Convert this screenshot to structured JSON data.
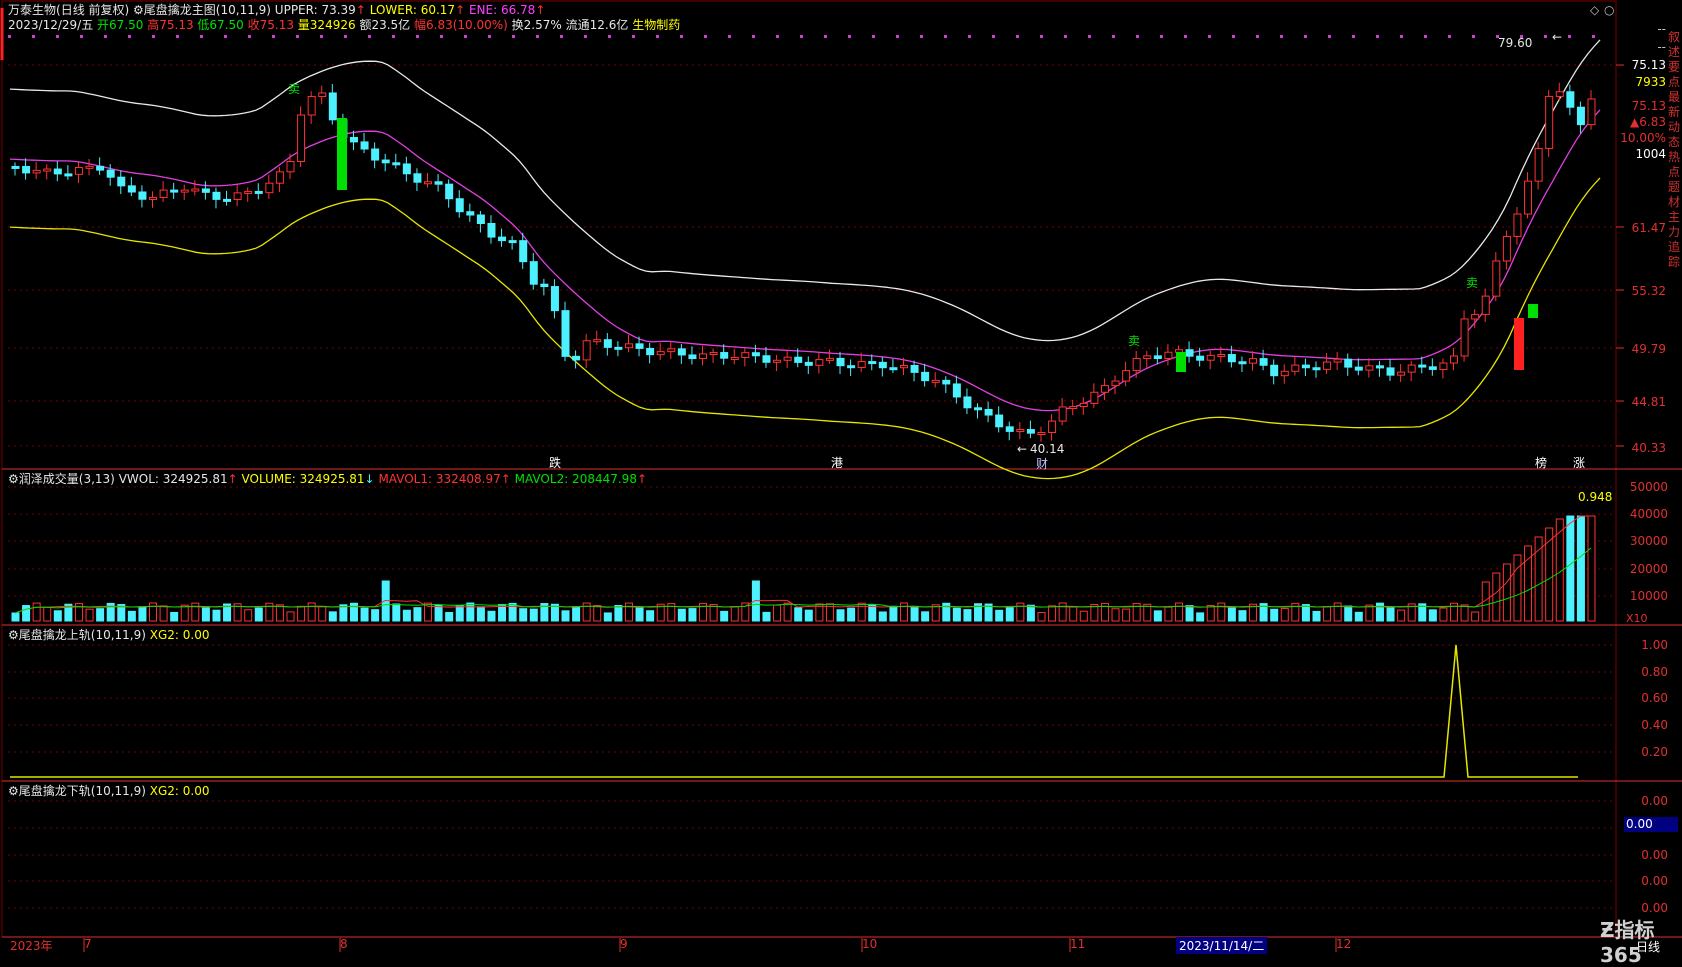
{
  "stock": {
    "name": "万泰生物",
    "period": "(日线 前复权)"
  },
  "main_indicator": {
    "name": "尾盘擒龙主图(10,11,9)",
    "upper_label": "UPPER: 73.39",
    "lower_label": "LOWER: 60.17",
    "ene_label": "ENE: 66.78"
  },
  "quote": {
    "date": "2023/12/29/五",
    "open": "开67.50",
    "high": "高75.13",
    "low": "低67.50",
    "close": "收75.13",
    "volume": "量324926",
    "amount": "额23.5亿",
    "change": "幅6.83(10.00%)",
    "turnover": "换2.57%",
    "float": "流通12.6亿",
    "sector": "生物制药"
  },
  "price_axis": {
    "ticks": [
      "75.13",
      "61.47",
      "55.32",
      "49.79",
      "44.81",
      "40.33"
    ],
    "current_price": "75.13",
    "change": "▲6.83",
    "change_pct": "10.00%",
    "lots": "1004",
    "top_dashes": [
      "--",
      "--"
    ],
    "volume_tag": "7933"
  },
  "annotations": {
    "high": "79.60",
    "low": "40.14",
    "sell1": "卖",
    "sell2": "卖",
    "buy": "卖"
  },
  "events": [
    "跌",
    "港",
    "财",
    "榜",
    "涨"
  ],
  "volume_panel": {
    "name": "润泽成交量(3,13)",
    "vwol": "VWOL: 324925.81",
    "volume": "VOLUME: 324925.81",
    "mavol1": "MAVOL1: 332408.97",
    "mavol2": "MAVOL2: 208447.98",
    "ticks": [
      "50000",
      "40000",
      "30000",
      "20000",
      "10000"
    ],
    "ratio": "0.948",
    "unit": "X10"
  },
  "upper_panel": {
    "name": "尾盘擒龙上轨(10,11,9)",
    "xg2": "XG2: 0.00",
    "ticks": [
      "1.00",
      "0.80",
      "0.60",
      "0.40",
      "0.20"
    ]
  },
  "lower_panel": {
    "name": "尾盘擒龙下轨(10,11,9)",
    "xg2": "XG2: 0.00",
    "ticks": [
      "0.00",
      "0.00",
      "0.00",
      "0.00",
      "0.00"
    ],
    "highlight": "0.00"
  },
  "x_axis": {
    "labels": [
      "2023年",
      "7",
      "8",
      "9",
      "10",
      "11",
      "12"
    ],
    "cursor": "2023/11/14/二",
    "period": "日线"
  },
  "right_tabs": "叙述要点最新动态热点题材主力追踪",
  "watermark": "指标365",
  "colors": {
    "bg": "#000000",
    "up": "#ff3232",
    "down": "#4df0ff",
    "grid": "#800000"
  }
}
